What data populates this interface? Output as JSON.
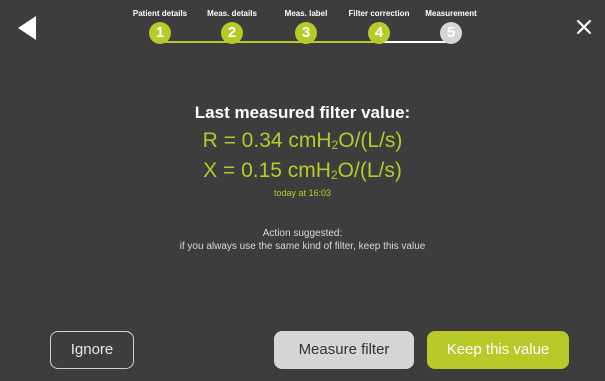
{
  "colors": {
    "background": "#3d3d3d",
    "accent": "#b8c92a",
    "inactive": "#d6d6d6"
  },
  "nav": {
    "back_icon": "back-arrow-icon",
    "close_icon": "close-icon"
  },
  "stepper": {
    "steps": [
      {
        "number": "1",
        "label": "Patient details",
        "state": "completed"
      },
      {
        "number": "2",
        "label": "Meas. details",
        "state": "completed"
      },
      {
        "number": "3",
        "label": "Meas. label",
        "state": "completed"
      },
      {
        "number": "4",
        "label": "Filter correction",
        "state": "completed"
      },
      {
        "number": "5",
        "label": "Measurement",
        "state": "pending"
      }
    ]
  },
  "content": {
    "heading": "Last measured filter value:",
    "r_prefix": "R = 0.34 cmH",
    "r_sub": "2",
    "r_suffix": "O/(L/s)",
    "x_prefix": "X = 0.15 cmH",
    "x_sub": "2",
    "x_suffix": "O/(L/s)",
    "timestamp": "today at 16:03",
    "action_title": "Action suggested:",
    "action_text": "if you always use the same kind of filter, keep this value"
  },
  "buttons": {
    "ignore": "Ignore",
    "measure_filter": "Measure filter",
    "keep_value": "Keep this value"
  }
}
